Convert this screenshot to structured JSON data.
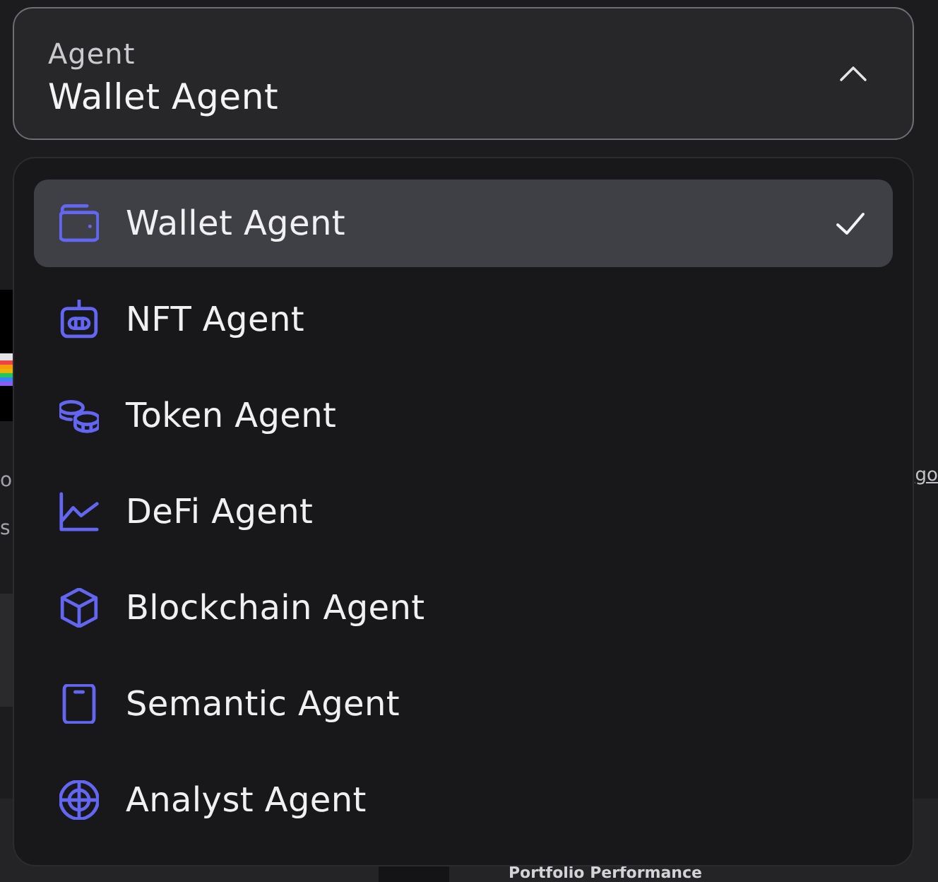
{
  "select": {
    "label": "Agent",
    "value": "Wallet Agent",
    "expanded": true
  },
  "menu": {
    "items": [
      {
        "label": "Wallet Agent",
        "kind": "wallet",
        "selected": true
      },
      {
        "label": "NFT Agent",
        "kind": "robot",
        "selected": false
      },
      {
        "label": "Token Agent",
        "kind": "coins",
        "selected": false
      },
      {
        "label": "DeFi Agent",
        "kind": "chart",
        "selected": false
      },
      {
        "label": "Blockchain Agent",
        "kind": "cube",
        "selected": false
      },
      {
        "label": "Semantic Agent",
        "kind": "tablet",
        "selected": false
      },
      {
        "label": "Analyst Agent",
        "kind": "crosshair",
        "selected": false
      }
    ]
  },
  "background": {
    "left_text_lines": [
      "o",
      "s"
    ],
    "right_link": "go",
    "heading": "Portfolio Performance"
  }
}
